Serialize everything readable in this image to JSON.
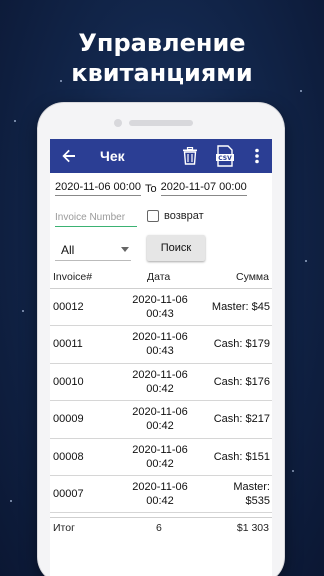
{
  "promo": {
    "line1": "Управление",
    "line2": "квитанциями"
  },
  "appbar": {
    "title": "Чек",
    "color": "#2b3e94",
    "icons": [
      "back-arrow-icon",
      "trash-icon",
      "csv-file-icon",
      "more-vert-icon"
    ]
  },
  "filters": {
    "date_from": "2020-11-06 00:00",
    "to_label": "To",
    "date_to": "2020-11-07 00:00",
    "invoice_placeholder": "Invoice Number",
    "return_label": "возврат",
    "return_checked": false,
    "select_value": "All",
    "search_label": "Поиск"
  },
  "table": {
    "headers": [
      "Invoice#",
      "Дата",
      "Сумма"
    ],
    "rows": [
      {
        "invoice": "00012",
        "date": "2020-11-06",
        "time": "00:43",
        "sum1": "Master: $45",
        "sum2": ""
      },
      {
        "invoice": "00011",
        "date": "2020-11-06",
        "time": "00:43",
        "sum1": "Cash: $179",
        "sum2": ""
      },
      {
        "invoice": "00010",
        "date": "2020-11-06",
        "time": "00:42",
        "sum1": "Cash: $176",
        "sum2": ""
      },
      {
        "invoice": "00009",
        "date": "2020-11-06",
        "time": "00:42",
        "sum1": "Cash: $217",
        "sum2": ""
      },
      {
        "invoice": "00008",
        "date": "2020-11-06",
        "time": "00:42",
        "sum1": "Cash: $151",
        "sum2": ""
      },
      {
        "invoice": "00007",
        "date": "2020-11-06",
        "time": "00:42",
        "sum1": "Master:",
        "sum2": "$535"
      }
    ],
    "footer": {
      "label": "Итог",
      "count": "6",
      "total": "$1 303"
    }
  }
}
